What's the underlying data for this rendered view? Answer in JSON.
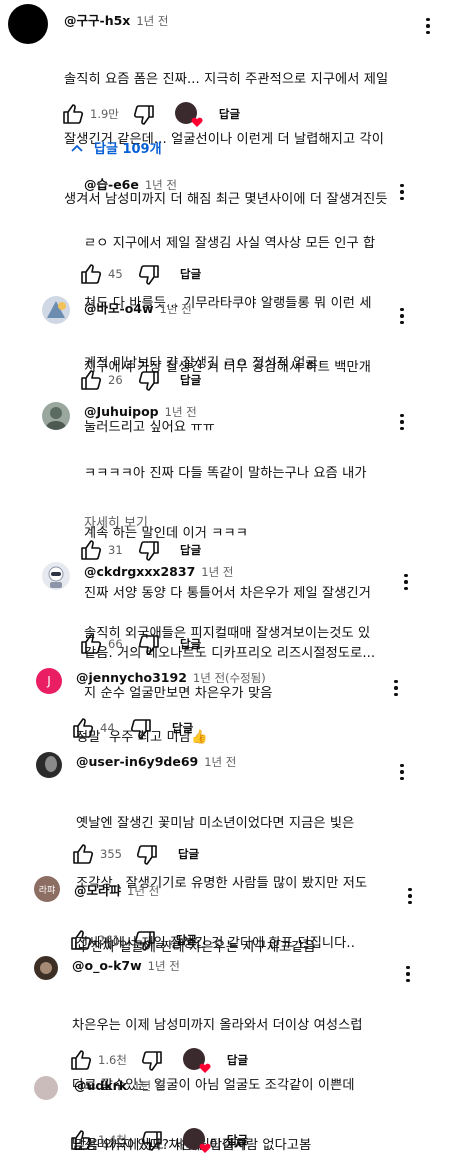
{
  "top": {
    "handle": "@구구-h5x",
    "time": "1년 전",
    "lines": [
      "솔직히 요즘 폼은 진짜... 지극히 주관적으로 지구에서 제일",
      "잘생긴거 같은데... 얼굴선이나 이런게 더 날렵해지고 각이",
      "생겨서 남성미까지 더 해짐 최근 몇년사이에 더 잘생겨진듯"
    ],
    "likes": "1.9만",
    "reply_label": "답글"
  },
  "replies_toggle": "답글 109개",
  "replies": [
    {
      "handle": "@습-e6e",
      "time": "1년 전",
      "lines": [
        "ㄹㅇ 지구에서 제일 잘생김 사실 역사상 모든 인구 합",
        "쳐도 다 바를듯... 기무라타쿠야 알랭들롱 뭐 이런 세",
        "계적 미남보다 걍 잘생김 ㄹㅇ 정석적 얼굴"
      ],
      "likes": "45",
      "reply_label": "답글"
    },
    {
      "handle": "@바모-o4w",
      "time": "1년 전",
      "lines": [
        "지구에서 가장 잘생긴 거 너무 공감해서 하트 백만개",
        "눌러드리고 싶어요 ㅠㅠ"
      ],
      "likes": "26",
      "reply_label": "답글"
    },
    {
      "handle": "@Juhuipop",
      "time": "1년 전",
      "lines": [
        "ㅋㅋㅋㅋ아 진짜 다들 똑같이 말하는구나 요즘 내가",
        "계속 하는 말인데 이거 ㅋㅋㅋ",
        "진짜 서양 동양 다 통틀어서 차은우가 제일 잘생긴거",
        "같음. 거의 레오나르도 디카프리오 리즈시절정도로..."
      ],
      "read_more": "자세히 보기",
      "likes": "31",
      "reply_label": "답글"
    },
    {
      "handle": "@ckdrgxxx2837",
      "time": "1년 전",
      "lines": [
        "솔직히 외국애들은 피지컬때매 잘생겨보이는것도 있",
        "지 순수 얼굴만보면 차은우가 맞음"
      ],
      "likes": "66",
      "reply_label": "답글"
    },
    {
      "handle": "@jennycho3192",
      "time": "1년 전(수정됨)",
      "lines": [
        "정말  우주 최고 미남👍"
      ],
      "likes": "44",
      "reply_label": "답글",
      "initial": "J"
    },
    {
      "handle": "@user-in6y9de69",
      "time": "1년 전",
      "lines": [
        "옛날엔 잘생긴 꽃미남 미소년이었다면 지금은 빛은",
        "조각상.. 잘생기기로 유명한 사람들 많이 봤지만 저도",
        "전세계에서 제일 잘생긴 것 같다에 한표 던집니다.."
      ],
      "likes": "355",
      "reply_label": "답글"
    },
    {
      "handle": "@모라퍄",
      "time": "1년 전",
      "lines": [
        "나 진짜 얼굴에 짠데 차은우는 지구채고같음"
      ],
      "likes": "261",
      "reply_label": "답글",
      "initial": "라퍄"
    },
    {
      "handle": "@o_o-k7w",
      "time": "1년 전",
      "lines": [
        "차은우는 이제 남성미까지 올라와서 더이상 여성스럽",
        "다로 깔수있는 얼굴이 아님 얼굴도 조각같이 이쁜데",
        "남성미까지 있다? 세계원탑이지"
      ],
      "likes": "1.6천",
      "reply_label": "답글"
    },
    {
      "handle": "@udkrk",
      "time": "1년 전",
      "lines": [
        "맞음 외국에서도 차은우 이길사람 없다고봄"
      ],
      "likes": "1.4천",
      "reply_label": "답글"
    }
  ],
  "colors": {
    "link": "#065fd4",
    "heart": "#ff0033",
    "meta": "#606060"
  },
  "icons": [
    "thumb-up-icon",
    "thumb-down-icon",
    "more-vert-icon",
    "chevron-up-icon",
    "creator-heart-icon"
  ]
}
